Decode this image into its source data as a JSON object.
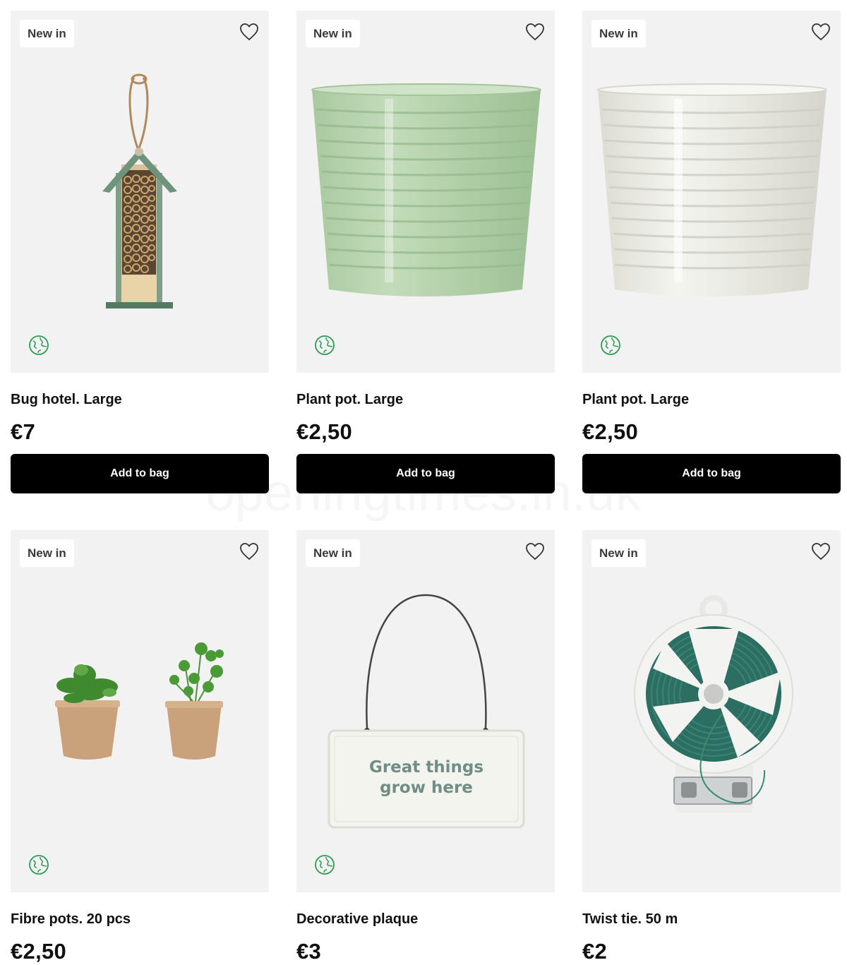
{
  "products": [
    {
      "badge": "New in",
      "title": "Bug hotel. Large",
      "price": "€7",
      "button": "Add to bag",
      "eco": true,
      "image": "bug-hotel"
    },
    {
      "badge": "New in",
      "title": "Plant pot. Large",
      "price": "€2,50",
      "button": "Add to bag",
      "eco": true,
      "image": "plant-pot-green",
      "pot_color": "#b9d6b0"
    },
    {
      "badge": "New in",
      "title": "Plant pot. Large",
      "price": "€2,50",
      "button": "Add to bag",
      "eco": true,
      "image": "plant-pot-white",
      "pot_color": "#eeeee8"
    },
    {
      "badge": "New in",
      "title": "Fibre pots. 20 pcs",
      "price": "€2,50",
      "eco": true,
      "image": "fibre-pots"
    },
    {
      "badge": "New in",
      "title": "Decorative plaque",
      "price": "€3",
      "eco": true,
      "image": "decorative-plaque",
      "plaque_text_line1": "Great things",
      "plaque_text_line2": "grow here"
    },
    {
      "badge": "New in",
      "title": "Twist tie. 50 m",
      "price": "€2",
      "eco": false,
      "image": "twist-tie"
    }
  ],
  "icons": {
    "favorite": "heart-outline-icon",
    "eco": "globe-icon"
  },
  "colors": {
    "button_bg": "#000000",
    "card_bg": "#f2f2f2",
    "eco_green": "#2e9b57"
  },
  "watermark": "openingtimes.in.uk"
}
